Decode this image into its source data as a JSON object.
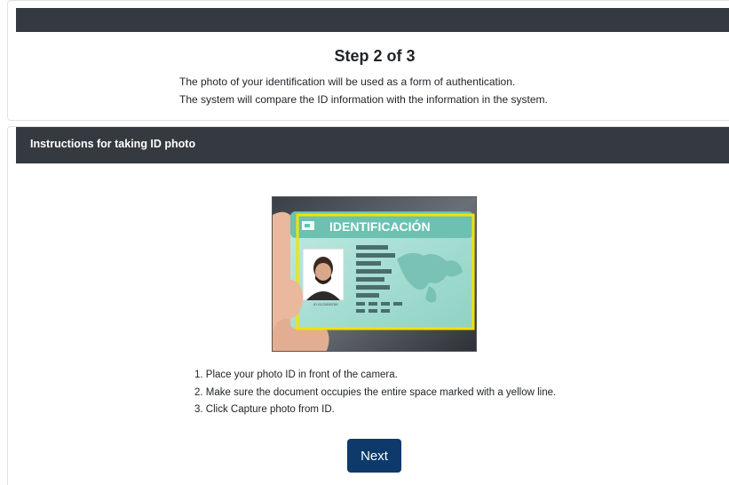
{
  "step": {
    "title": "Step 2 of 3",
    "description_lines": [
      "The photo of your identification will be used as a form of authentication.",
      "The system will compare the ID information with the information in the system."
    ]
  },
  "instructions_panel": {
    "header": "Instructions for taking ID photo",
    "image": {
      "card_title": "IDENTIFICACIÓN",
      "card_id_text": "ID 0123456789",
      "frame_color": "#f2e200",
      "card_color": "#9fdcd0"
    },
    "steps": [
      "1. Place your photo ID in front of the camera.",
      "2. Make sure the document occupies the entire space marked with a yellow line.",
      "3. Click Capture photo from ID."
    ]
  },
  "next_button": {
    "label": "Next",
    "color": "#0d3a6b"
  }
}
